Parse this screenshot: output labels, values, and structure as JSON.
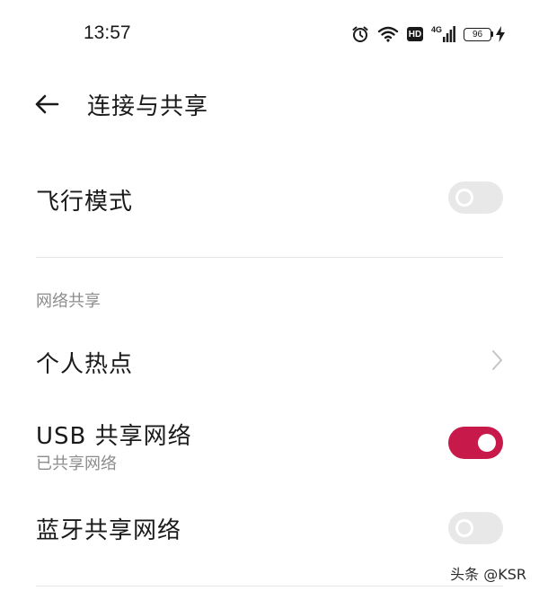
{
  "status_bar": {
    "time": "13:57",
    "network_label": "4G",
    "hd_label": "HD",
    "battery_level": "96"
  },
  "header": {
    "title": "连接与共享"
  },
  "settings": {
    "airplane_mode": {
      "label": "飞行模式",
      "enabled": false
    },
    "tethering_section": "网络共享",
    "hotspot": {
      "label": "个人热点"
    },
    "usb_tethering": {
      "label": "USB 共享网络",
      "sub": "已共享网络",
      "enabled": true
    },
    "bluetooth_tethering": {
      "label": "蓝牙共享网络",
      "enabled": false
    }
  },
  "watermark": "头条 @KSR",
  "colors": {
    "accent": "#c8194b",
    "switch_off": "#e8e8e8",
    "secondary_text": "#8c8c8c",
    "divider": "#e6e6e6"
  }
}
